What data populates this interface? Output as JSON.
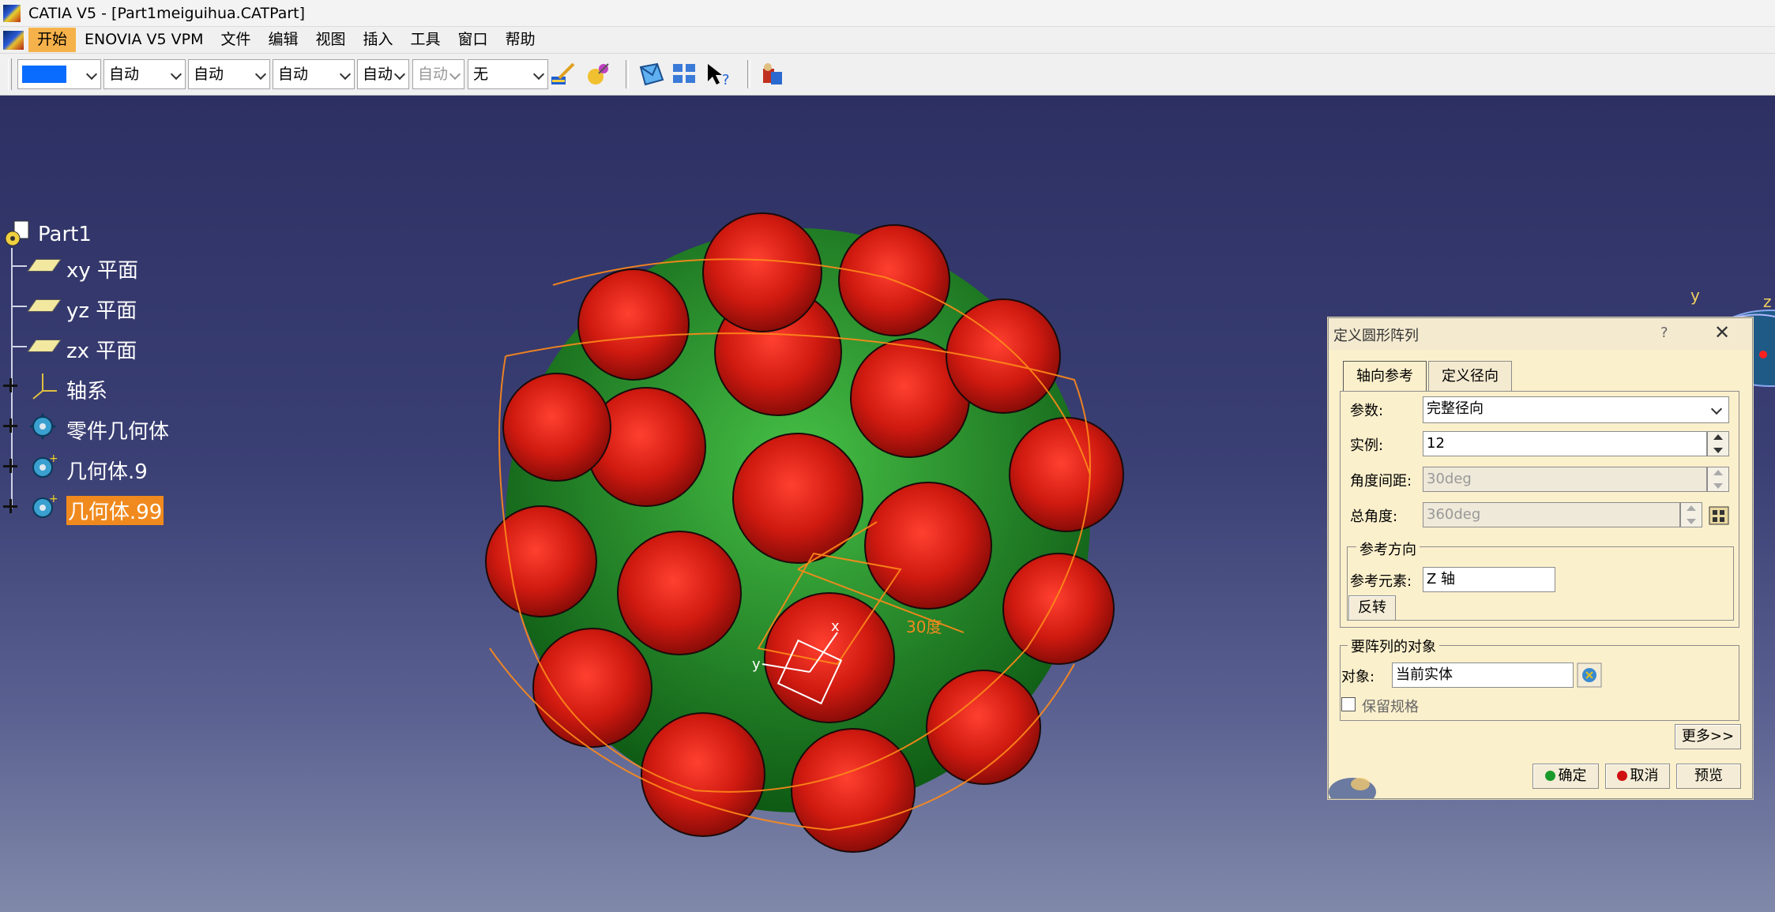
{
  "window": {
    "title": "CATIA V5 - [Part1meiguihua.CATPart]"
  },
  "menu": {
    "items": [
      "开始",
      "ENOVIA V5 VPM",
      "文件",
      "编辑",
      "视图",
      "插入",
      "工具",
      "窗口",
      "帮助"
    ]
  },
  "toolbar": {
    "combos": [
      "",
      "自动",
      "自动",
      "自动",
      "自动",
      "自动",
      "无"
    ],
    "color_swatch": "#0a6cff"
  },
  "tree": {
    "root": "Part1",
    "items": [
      "xy 平面",
      "yz 平面",
      "zx 平面",
      "轴系",
      "零件几何体",
      "几何体.9",
      "几何体.99"
    ]
  },
  "viewport": {
    "annotation": "30度",
    "axis_labels": [
      "y",
      "z",
      "x"
    ]
  },
  "dialog": {
    "title": "定义圆形阵列",
    "help": "?",
    "close": "✕",
    "tabs": [
      "轴向参考",
      "定义径向"
    ],
    "params_label": "参数:",
    "params_value": "完整径向",
    "instances_label": "实例:",
    "instances_value": "12",
    "angle_spacing_label": "角度间距:",
    "angle_spacing_value": "30deg",
    "total_angle_label": "总角度:",
    "total_angle_value": "360deg",
    "ref_direction_title": "参考方向",
    "ref_element_label": "参考元素:",
    "ref_element_value": "Z 轴",
    "reverse_button": "反转",
    "objects_title": "要阵列的对象",
    "object_label": "对象:",
    "object_value": "当前实体",
    "keep_spec_label": "保留规格",
    "keep_spec_checked": false,
    "more_button": "更多>>",
    "ok_button": "确定",
    "cancel_button": "取消",
    "preview_button": "预览"
  }
}
